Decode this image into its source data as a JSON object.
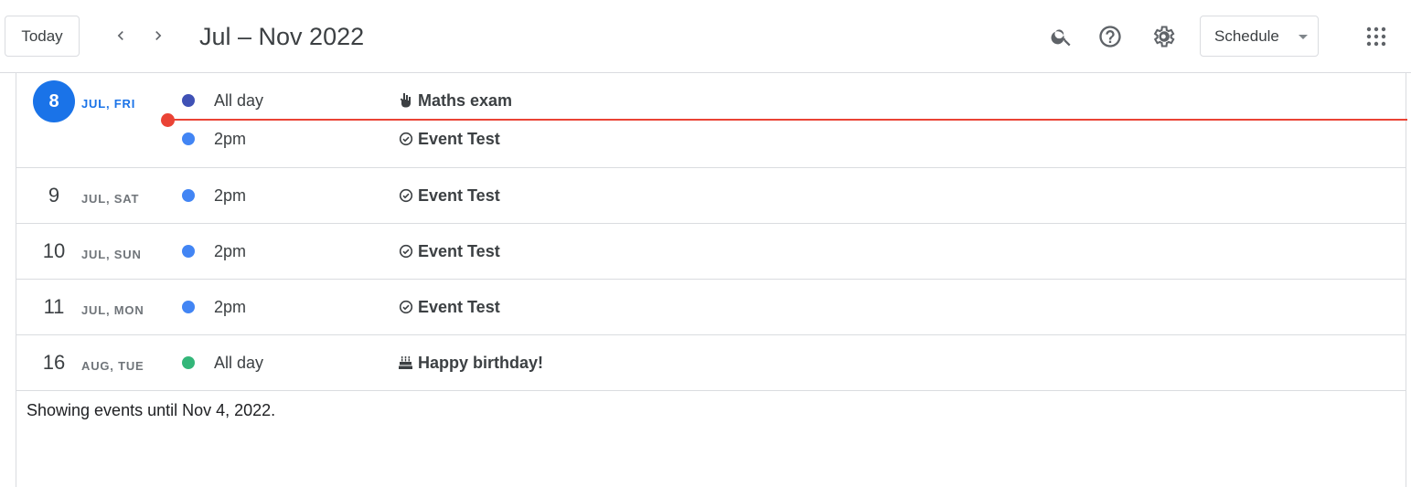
{
  "header": {
    "today_label": "Today",
    "prev_icon": "chevron-left-icon",
    "next_icon": "chevron-right-icon",
    "period_title": "Jul – Nov 2022",
    "search_icon": "search-icon",
    "help_icon": "help-icon",
    "settings_icon": "gear-icon",
    "view_select": {
      "selected": "Schedule"
    },
    "apps_icon": "apps-grid-icon"
  },
  "schedule": {
    "days": [
      {
        "day_number": "8",
        "day_label": "JUL, FRI",
        "is_today": true,
        "events": [
          {
            "time": "All day",
            "title": "Maths exam",
            "dot_color": "#3f51b5",
            "icon": "hand-icon"
          },
          {
            "time": "2pm",
            "title": "Event Test",
            "dot_color": "#4285f4",
            "icon": "task-check-icon"
          }
        ]
      },
      {
        "day_number": "9",
        "day_label": "JUL, SAT",
        "is_today": false,
        "events": [
          {
            "time": "2pm",
            "title": "Event Test",
            "dot_color": "#4285f4",
            "icon": "task-check-icon"
          }
        ]
      },
      {
        "day_number": "10",
        "day_label": "JUL, SUN",
        "is_today": false,
        "events": [
          {
            "time": "2pm",
            "title": "Event Test",
            "dot_color": "#4285f4",
            "icon": "task-check-icon"
          }
        ]
      },
      {
        "day_number": "11",
        "day_label": "JUL, MON",
        "is_today": false,
        "events": [
          {
            "time": "2pm",
            "title": "Event Test",
            "dot_color": "#4285f4",
            "icon": "task-check-icon"
          }
        ]
      },
      {
        "day_number": "16",
        "day_label": "AUG, TUE",
        "is_today": false,
        "events": [
          {
            "time": "All day",
            "title": "Happy birthday!",
            "dot_color": "#33b679",
            "icon": "cake-icon"
          }
        ]
      }
    ],
    "footer_note": "Showing events until Nov 4, 2022.",
    "colors": {
      "today_accent": "#1a73e8",
      "now_indicator": "#ea4335"
    }
  }
}
